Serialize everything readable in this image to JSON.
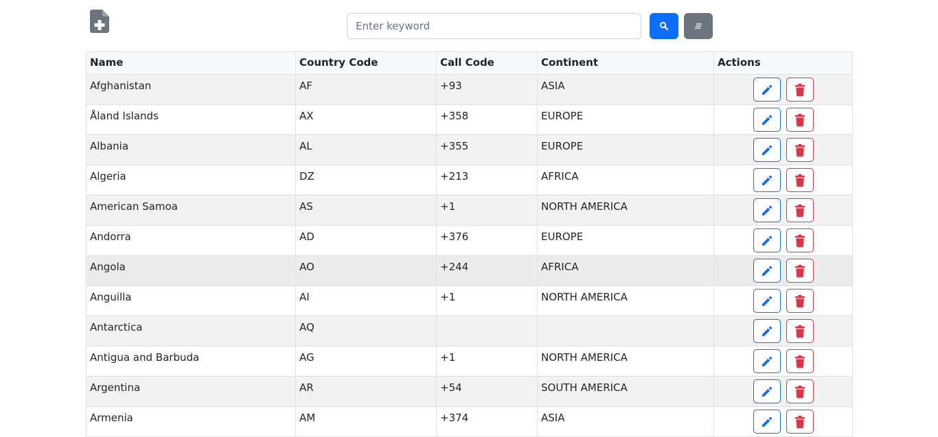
{
  "toolbar": {
    "add_icon": "file-plus-icon",
    "search_placeholder": "Enter keyword",
    "search_value": "",
    "search_icon": "search-icon",
    "clear_icon": "eraser-icon"
  },
  "colors": {
    "primary": "#0d6efd",
    "secondary": "#6c757d",
    "danger": "#dc3545",
    "icon_gray": "#6c757d"
  },
  "table": {
    "columns": [
      "Name",
      "Country Code",
      "Call Code",
      "Continent",
      "Actions"
    ],
    "rows": [
      {
        "name": "Afghanistan",
        "code": "AF",
        "call": "+93",
        "continent": "ASIA"
      },
      {
        "name": "Åland Islands",
        "code": "AX",
        "call": "+358",
        "continent": "EUROPE"
      },
      {
        "name": "Albania",
        "code": "AL",
        "call": "+355",
        "continent": "EUROPE"
      },
      {
        "name": "Algeria",
        "code": "DZ",
        "call": "+213",
        "continent": "AFRICA"
      },
      {
        "name": "American Samoa",
        "code": "AS",
        "call": "+1",
        "continent": "NORTH AMERICA"
      },
      {
        "name": "Andorra",
        "code": "AD",
        "call": "+376",
        "continent": "EUROPE"
      },
      {
        "name": "Angola",
        "code": "AO",
        "call": "+244",
        "continent": "AFRICA"
      },
      {
        "name": "Anguilla",
        "code": "AI",
        "call": "+1",
        "continent": "NORTH AMERICA"
      },
      {
        "name": "Antarctica",
        "code": "AQ",
        "call": "",
        "continent": ""
      },
      {
        "name": "Antigua and Barbuda",
        "code": "AG",
        "call": "+1",
        "continent": "NORTH AMERICA"
      },
      {
        "name": "Argentina",
        "code": "AR",
        "call": "+54",
        "continent": "SOUTH AMERICA"
      },
      {
        "name": "Armenia",
        "code": "AM",
        "call": "+374",
        "continent": "ASIA"
      }
    ],
    "row_actions": {
      "edit_icon": "pencil-icon",
      "delete_icon": "trash-icon"
    }
  }
}
